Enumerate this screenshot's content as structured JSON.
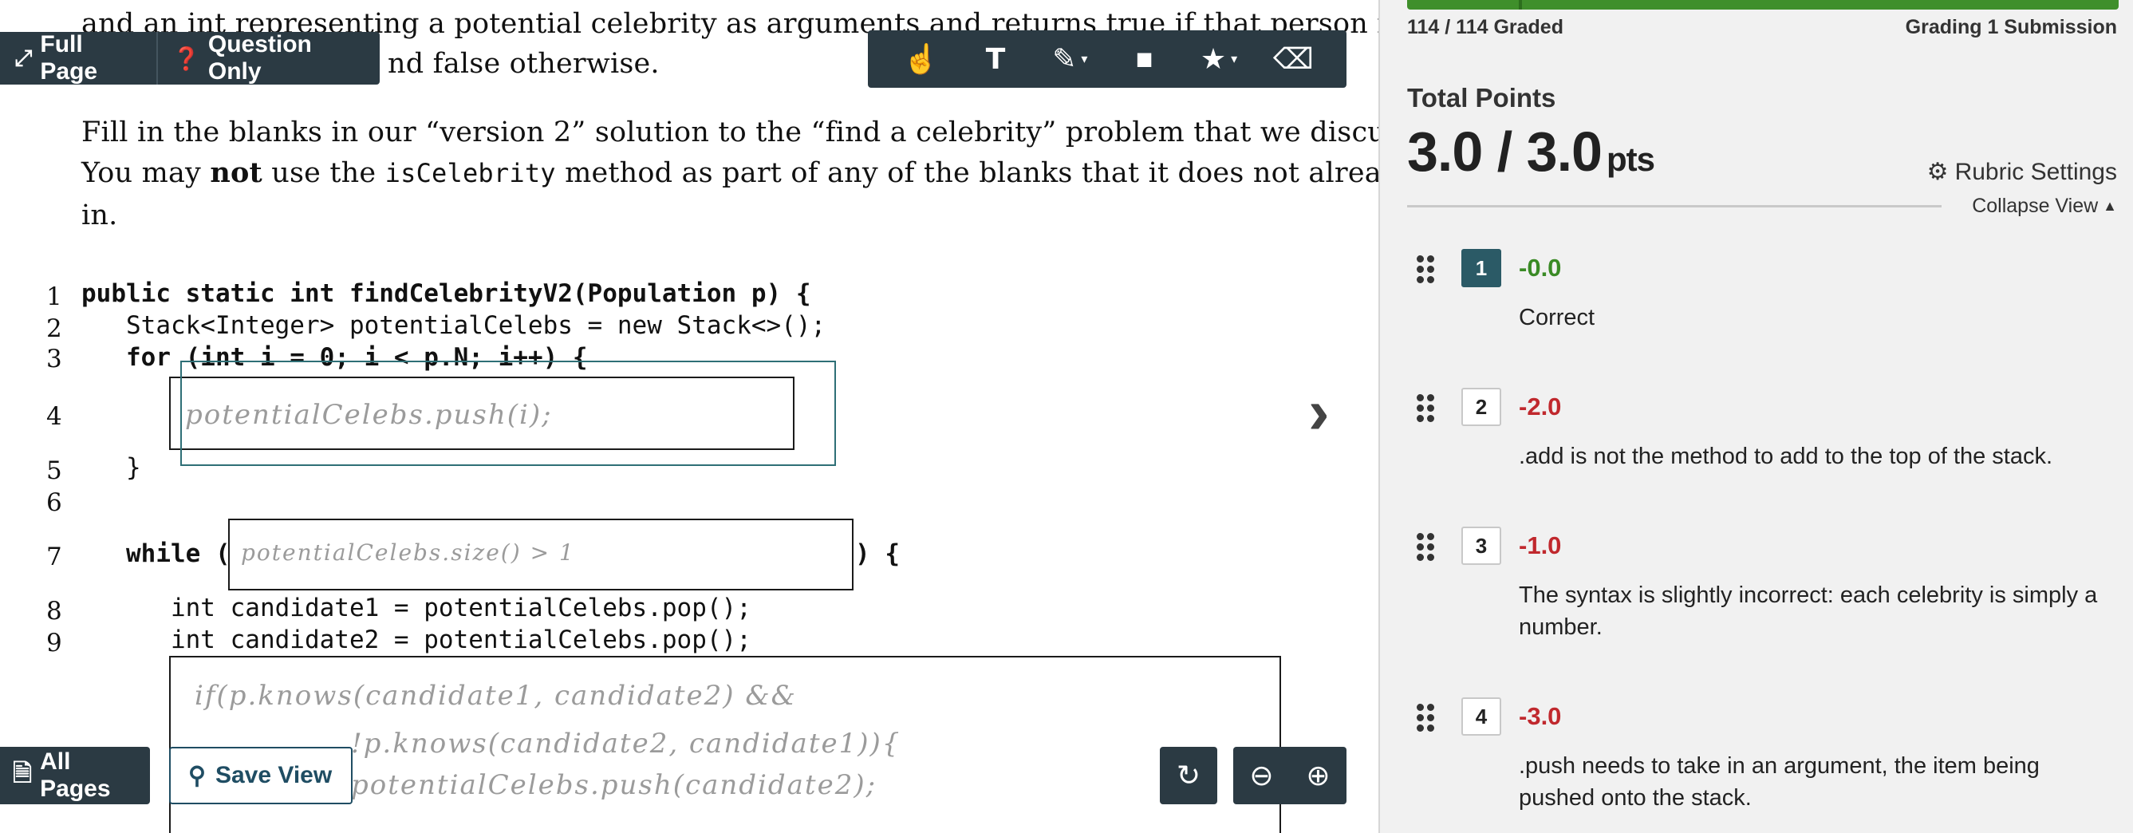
{
  "question": {
    "line0": "and an int representing a potential celebrity as arguments and returns true if that person is a ce",
    "line1": "nd false otherwise.",
    "para1": "Fill in the blanks in our “version 2” solution to the “find a celebrity” problem that we discussed in le",
    "para2_a": "You may ",
    "para2_not": "not",
    "para2_b": " use the ",
    "para2_code": "isCelebrity",
    "para2_c": " method as part of any of the blanks that it does not already a",
    "para3": "in."
  },
  "code": {
    "lines": [
      {
        "no": "1",
        "text": "public static int findCelebrityV2(Population p) {"
      },
      {
        "no": "2",
        "text": "   Stack<Integer> potentialCelebs = new Stack<>();"
      },
      {
        "no": "3",
        "text": "   for (int i = 0; i < p.N; i++) {"
      },
      {
        "no": "4",
        "text": ""
      },
      {
        "no": "5",
        "text": "   }"
      },
      {
        "no": "6",
        "text": ""
      },
      {
        "no": "7",
        "text": "   while ("
      },
      {
        "no": "8",
        "text": "      int candidate1 = potentialCelebs.pop();"
      },
      {
        "no": "9",
        "text": "      int candidate2 = potentialCelebs.pop();"
      }
    ],
    "while_close": ") {",
    "handwriting_1": "potentialCelebs.push(i);",
    "handwriting_2": "potentialCelebs.size() > 1",
    "handwriting_3a": "if(p.knows(candidate1, candidate2) &&",
    "handwriting_3b": "!p.knows(candidate2, candidate1)){",
    "handwriting_3c": "potentialCelebs.push(candidate2);"
  },
  "viewer": {
    "full_page": "Full Page",
    "question_only": "Question Only",
    "all_pages": "All Pages",
    "save_view": "Save View",
    "tools": [
      "pointer-icon",
      "text-icon",
      "pen-icon",
      "box-icon",
      "star-icon",
      "eraser-icon"
    ]
  },
  "panel": {
    "graded": "114 / 114 Graded",
    "grading": "Grading 1 Submission",
    "progress_fraction": 1.0,
    "total_label": "Total Points",
    "score": "3.0 / 3.0",
    "score_unit": "pts",
    "rubric_settings": "Rubric Settings",
    "collapse_view": "Collapse View",
    "items": [
      {
        "num": "1",
        "points": "-0.0",
        "desc": "Correct",
        "active": true,
        "color": "#3a8a25"
      },
      {
        "num": "2",
        "points": "-2.0",
        "desc": ".add is not the method to add to the top of the stack.",
        "active": false,
        "color": "#c0282d"
      },
      {
        "num": "3",
        "points": "-1.0",
        "desc": "The syntax is slightly incorrect: each celebrity is simply a number.",
        "active": false,
        "color": "#c0282d"
      },
      {
        "num": "4",
        "points": "-3.0",
        "desc": ".push needs to take in an argument, the item being pushed onto the stack.",
        "active": false,
        "color": "#c0282d"
      }
    ]
  }
}
